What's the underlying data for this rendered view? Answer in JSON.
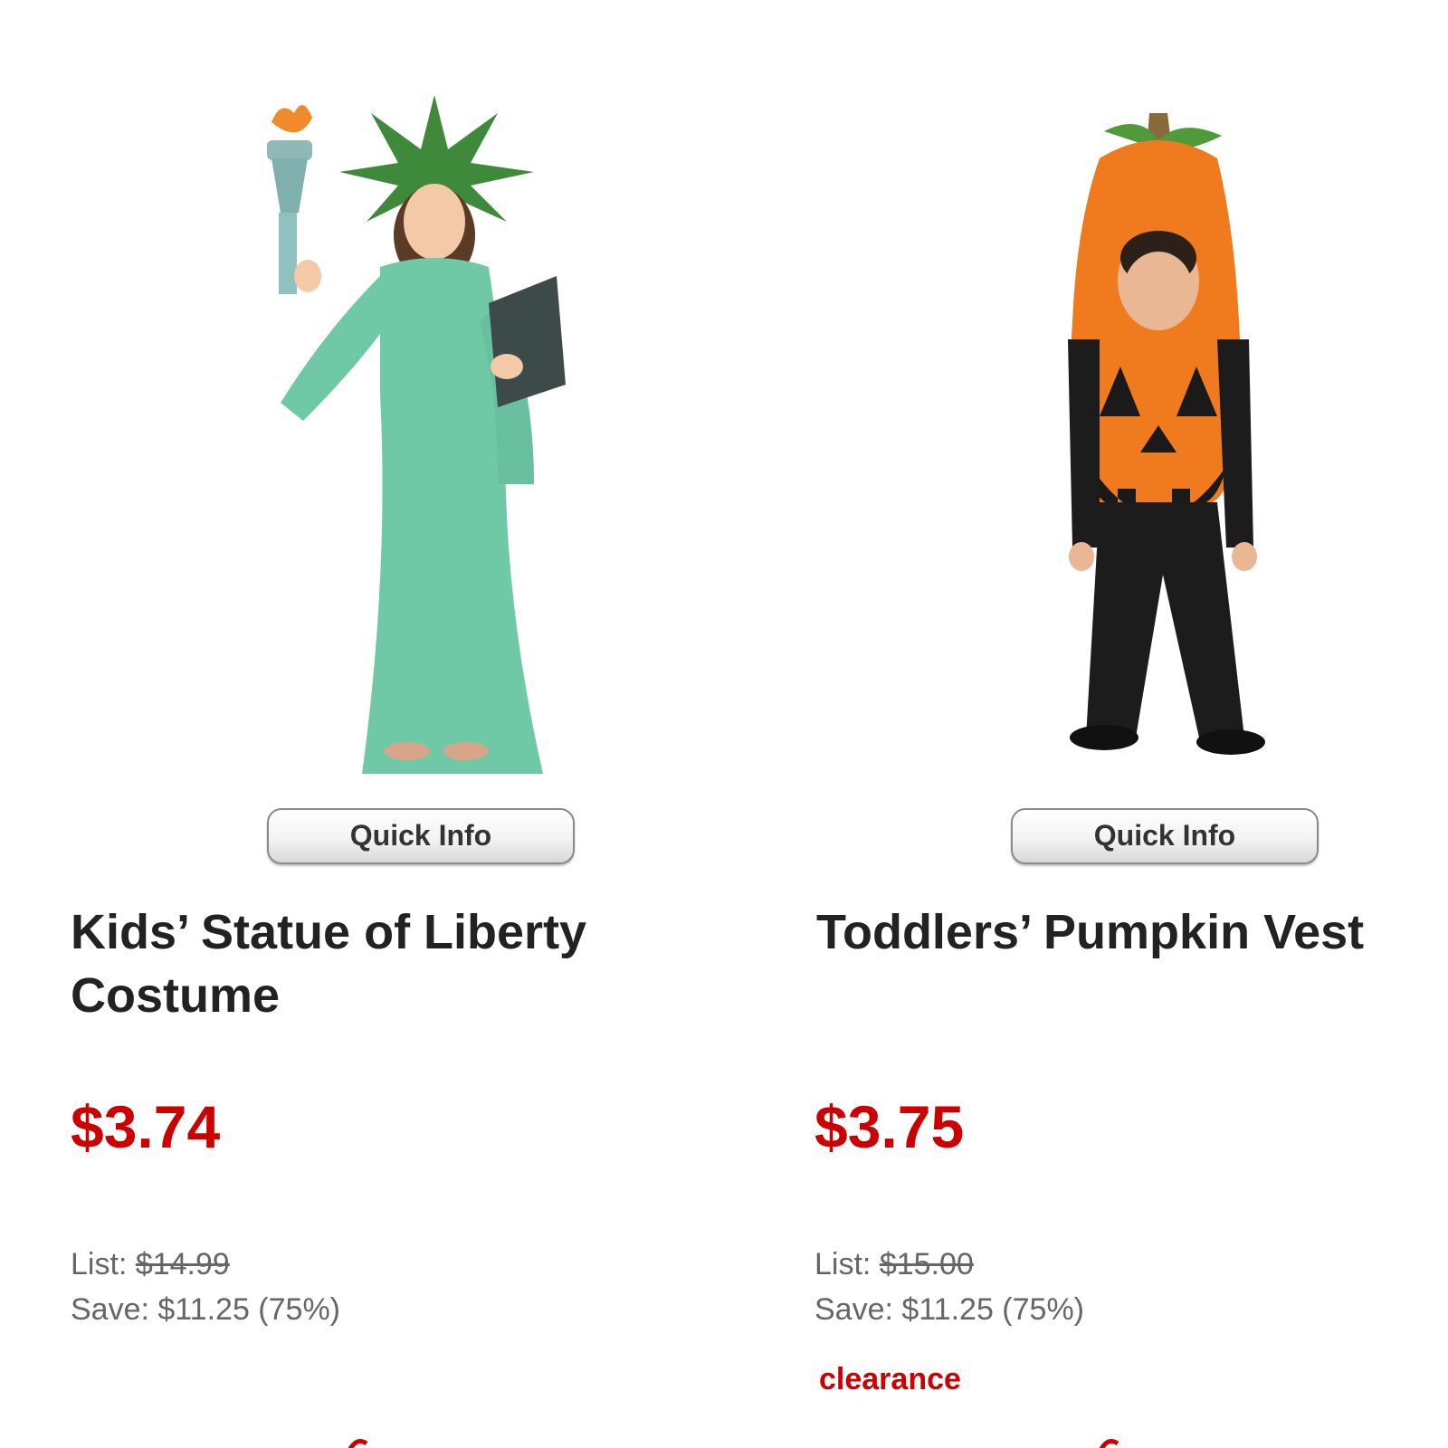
{
  "products": [
    {
      "title": "Kids’ Statue of Liberty Costume",
      "image_icon": "statue-of-liberty-costume-image",
      "quick_info_label": "Quick Info",
      "price": "$3.74",
      "list_label": "List:",
      "list_price": "$14.99",
      "save_text": "Save: $11.25 (75%)",
      "badge": ""
    },
    {
      "title": "Toddlers’ Pumpkin Vest",
      "image_icon": "pumpkin-vest-costume-image",
      "quick_info_label": "Quick Info",
      "price": "$3.75",
      "list_label": "List:",
      "list_price": "$15.00",
      "save_text": "Save: $11.25 (75%)",
      "badge": "clearance"
    }
  ],
  "colors": {
    "price_red": "#cc0000",
    "liberty_green": "#6fc9a6",
    "pumpkin_orange": "#f07a1e"
  }
}
